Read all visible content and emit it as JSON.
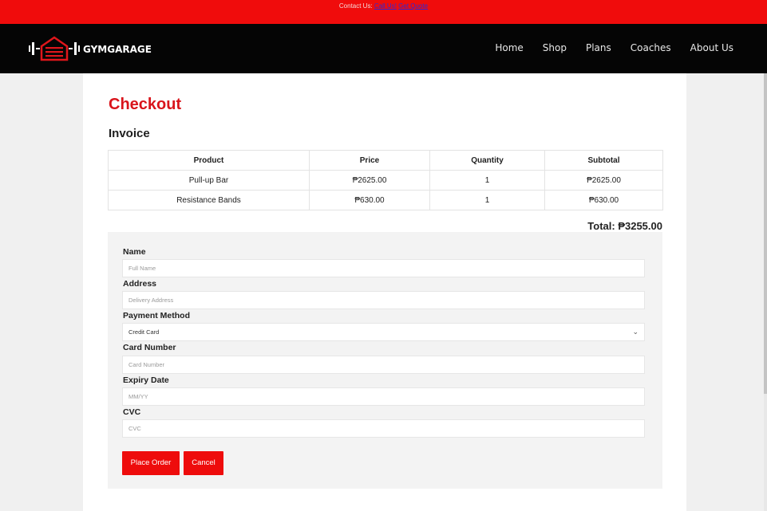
{
  "topbar": {
    "contact_text": "Contact Us:",
    "call_link": "Call Us!",
    "quote_link": "Get Quote"
  },
  "header": {
    "brand": "GYMGARAGE",
    "nav": [
      "Home",
      "Shop",
      "Plans",
      "Coaches",
      "About Us"
    ]
  },
  "checkout": {
    "title": "Checkout",
    "invoice_title": "Invoice",
    "columns": [
      "Product",
      "Price",
      "Quantity",
      "Subtotal"
    ],
    "rows": [
      [
        "Pull-up Bar",
        "₱2625.00",
        "1",
        "₱2625.00"
      ],
      [
        "Resistance Bands",
        "₱630.00",
        "1",
        "₱630.00"
      ]
    ],
    "total": "Total: ₱3255.00"
  },
  "form": {
    "name_label": "Name",
    "name_placeholder": "Full Name",
    "address_label": "Address",
    "address_placeholder": "Delivery Address",
    "payment_label": "Payment Method",
    "payment_value": "Credit Card",
    "card_label": "Card Number",
    "card_placeholder": "Card Number",
    "expiry_label": "Expiry Date",
    "expiry_placeholder": "MM/YY",
    "cvc_label": "CVC",
    "cvc_placeholder": "CVC",
    "place_order": "Place Order",
    "cancel": "Cancel"
  },
  "colors": {
    "brand_red": "#ee0c0c",
    "navbar": "#050505"
  },
  "icons": [
    "garage-dumbbell-logo-icon",
    "chevron-down-icon"
  ]
}
